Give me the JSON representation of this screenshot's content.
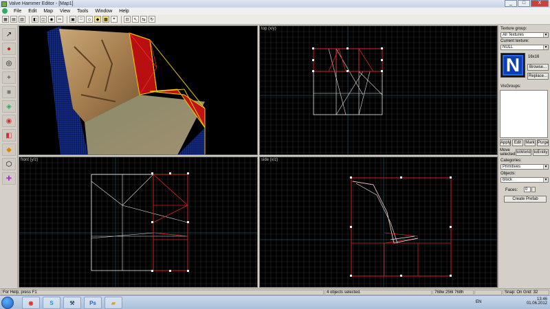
{
  "window": {
    "title": "Valve Hammer Editor - [Map1]",
    "controls": [
      "_",
      "□",
      "X"
    ]
  },
  "menu": [
    "File",
    "Edit",
    "Map",
    "View",
    "Tools",
    "Window",
    "Help"
  ],
  "toolbar": {
    "buttons": [
      "grid-icon",
      "grid-icon",
      "grid-icon",
      "hide-icon",
      "cube-icon",
      "camera-icon",
      "carve-icon",
      "group-icon",
      "ungroup-icon",
      "select-icon",
      "entity-icon",
      "texture-lock-icon",
      "snap-icon"
    ]
  },
  "tools": [
    "selection-icon",
    "magnify-icon",
    "camera-icon",
    "entity-icon",
    "block-icon",
    "texture-icon",
    "decal-icon",
    "clip-icon",
    "vertex-icon",
    "path-icon",
    "overlay-icon"
  ],
  "viewports": {
    "camera": {
      "label": ""
    },
    "top": {
      "label": "top (x/y)"
    },
    "front": {
      "label": "front (y/z)"
    },
    "side": {
      "label": "side (x/z)"
    }
  },
  "panel": {
    "texture_group_label": "Texture group:",
    "texture_group_value": "All Textures",
    "current_texture_label": "Current texture:",
    "current_texture_value": "NULL",
    "texture_size": "16x16",
    "texture_letter": "N",
    "browse_label": "Browse...",
    "replace_label": "Replace...",
    "visgroups_label": "VisGroups:",
    "vis_buttons": [
      "Apply",
      "Edit",
      "Mark",
      "Purge"
    ],
    "move_selected_label": "Move selected:",
    "to_world_label": "toWorld",
    "to_entity_label": "toEntity",
    "categories_label": "Categories:",
    "categories_value": "Primitives",
    "objects_label": "Objects:",
    "objects_value": "block",
    "faces_label": "Faces:",
    "faces_value": "0",
    "create_prefab_label": "Create Prefab"
  },
  "status": {
    "help": "For Help, press F1",
    "selection": "4 objects selected.",
    "size": "768w 256l 768h",
    "snap": "Snap: On Grid: 32"
  },
  "taskbar": {
    "apps": [
      "chrome-icon",
      "skype-icon",
      "hammer-icon",
      "photoshop-icon",
      "folder-icon"
    ],
    "lang": "EN",
    "time": "13:46",
    "date": "01.06.2012"
  },
  "colors": {
    "grid": "#2a2a2a",
    "selection": "#d42020",
    "wire": "#e8e8e8",
    "accent_yellow": "#f0d000"
  }
}
